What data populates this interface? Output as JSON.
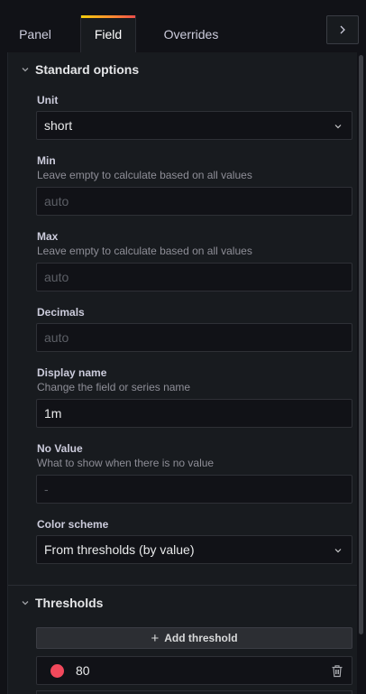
{
  "tabs": {
    "panel": "Panel",
    "field": "Field",
    "overrides": "Overrides"
  },
  "icons": {
    "collapse": "chevron-right-icon",
    "section_toggle": "chevron-down-icon",
    "select": "chevron-down-icon",
    "add": "plus-icon",
    "delete": "trash-icon"
  },
  "standard_options": {
    "title": "Standard options",
    "unit": {
      "label": "Unit",
      "value": "short"
    },
    "min": {
      "label": "Min",
      "description": "Leave empty to calculate based on all values",
      "placeholder": "auto"
    },
    "max": {
      "label": "Max",
      "description": "Leave empty to calculate based on all values",
      "placeholder": "auto"
    },
    "decimals": {
      "label": "Decimals",
      "placeholder": "auto"
    },
    "display_name": {
      "label": "Display name",
      "description": "Change the field or series name",
      "value": "1m"
    },
    "no_value": {
      "label": "No Value",
      "description": "What to show when there is no value",
      "placeholder": "-"
    },
    "color_scheme": {
      "label": "Color scheme",
      "value": "From thresholds (by value)"
    }
  },
  "thresholds": {
    "title": "Thresholds",
    "add_label": "Add threshold",
    "items": [
      {
        "value": "80",
        "color": "#f2495c"
      }
    ]
  },
  "colors": {
    "tab_accent_start": "#f2cc0c",
    "tab_accent_end": "#eb4d4a",
    "background": "#111217",
    "panel": "#181b1f"
  }
}
